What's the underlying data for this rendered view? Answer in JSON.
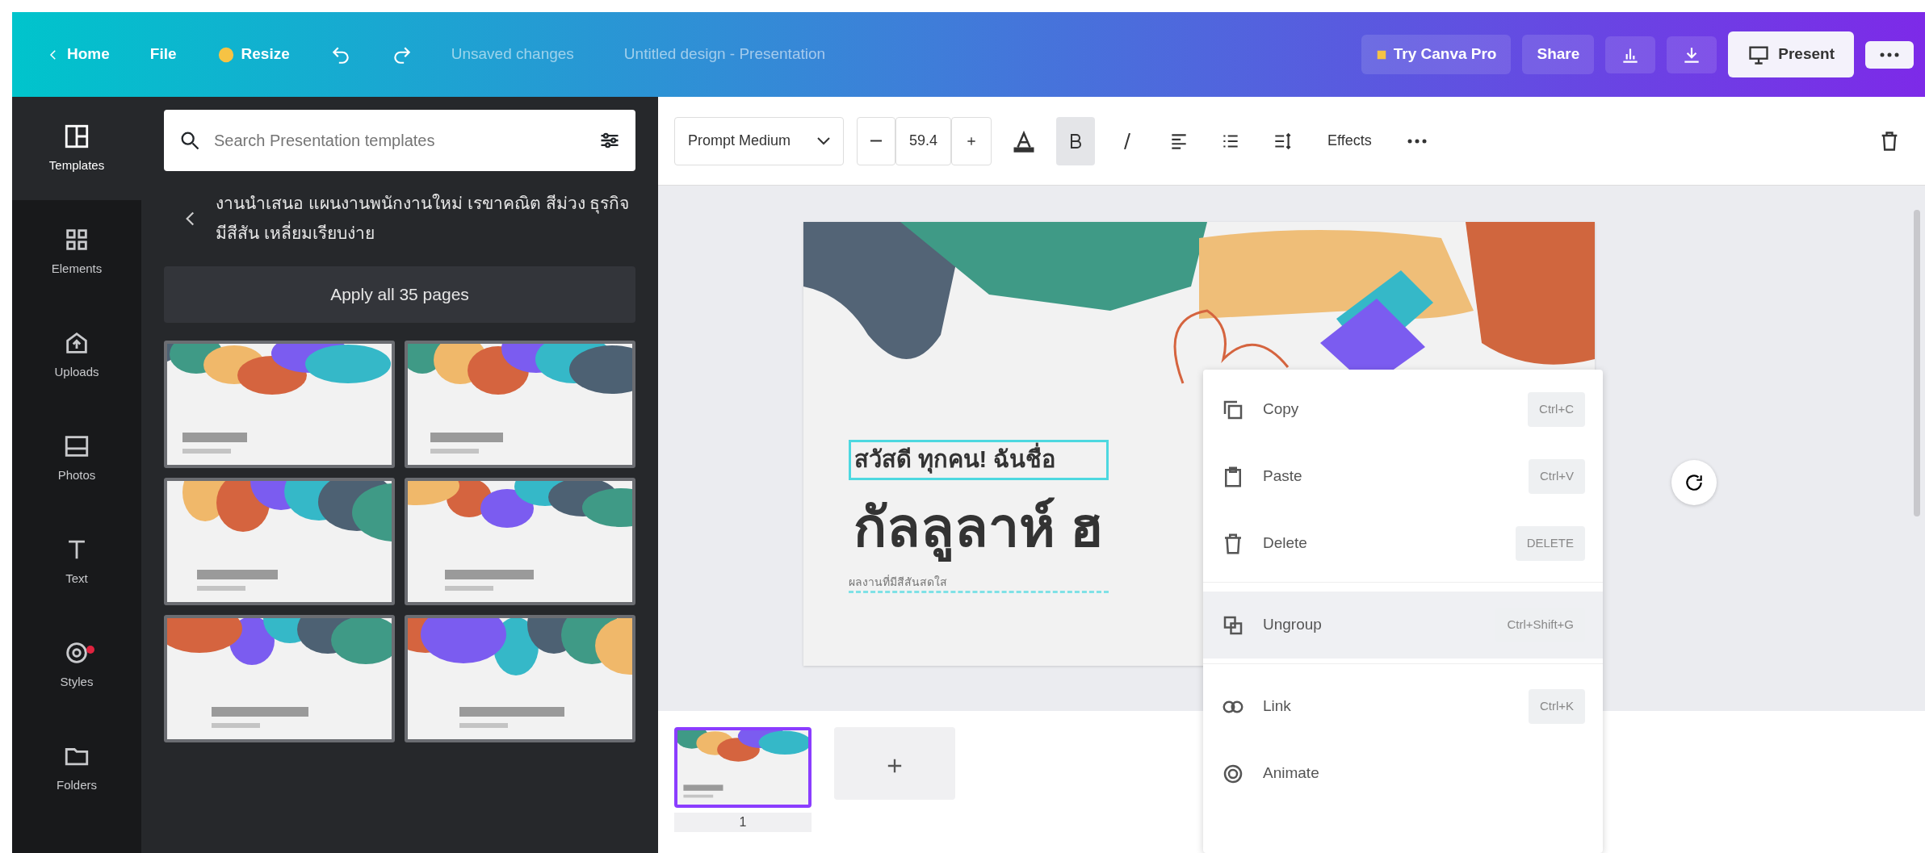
{
  "topbar": {
    "home": "Home",
    "file": "File",
    "resize": "Resize",
    "status": "Unsaved changes",
    "title": "Untitled design - Presentation",
    "pro": "Try Canva Pro",
    "share": "Share",
    "present": "Present"
  },
  "rail": [
    {
      "label": "Templates",
      "selected": true,
      "badge": false
    },
    {
      "label": "Elements",
      "selected": false,
      "badge": false
    },
    {
      "label": "Uploads",
      "selected": false,
      "badge": false
    },
    {
      "label": "Photos",
      "selected": false,
      "badge": false
    },
    {
      "label": "Text",
      "selected": false,
      "badge": false
    },
    {
      "label": "Styles",
      "selected": false,
      "badge": true
    },
    {
      "label": "Folders",
      "selected": false,
      "badge": false
    }
  ],
  "panel": {
    "search": {
      "placeholder": "Search Presentation templates"
    },
    "template_title": "งานนำเสนอ แผนงานพนักงานใหม่ เรขาคณิต สีม่วง ธุรกิจ มีสีสัน เหลี่ยมเรียบง่าย",
    "apply": "Apply all 35 pages"
  },
  "toolbar": {
    "font": "Prompt Medium",
    "size": "59.4",
    "bold": true,
    "italic": false,
    "effects": "Effects"
  },
  "slide": {
    "greeting": "สวัสดี ทุกคน! ฉันชื่อ",
    "name": "กัลลูลาห์ ฮ",
    "caption": "ผลงานที่มีสีสันสดใส"
  },
  "context_menu": [
    {
      "label": "Copy",
      "shortcut": "Ctrl+C",
      "selected": false
    },
    {
      "label": "Paste",
      "shortcut": "Ctrl+V",
      "selected": false
    },
    {
      "label": "Delete",
      "shortcut": "DELETE",
      "selected": false
    },
    {
      "label": "Ungroup",
      "shortcut": "Ctrl+Shift+G",
      "selected": true
    },
    {
      "label": "Link",
      "shortcut": "Ctrl+K",
      "selected": false
    },
    {
      "label": "Animate",
      "selected": false
    }
  ],
  "pages": [
    {
      "number": "1",
      "selected": true
    }
  ]
}
